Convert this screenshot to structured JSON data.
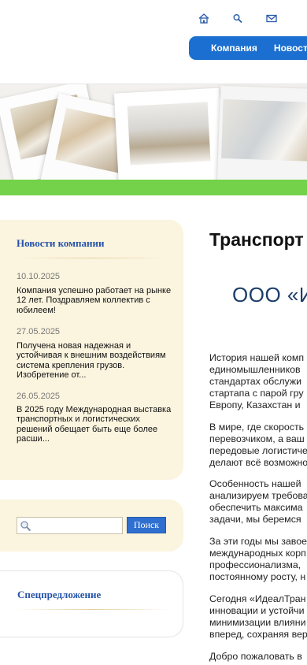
{
  "header": {
    "icons": [
      "home-icon",
      "search-icon",
      "mail-icon"
    ],
    "nav": [
      "Компания",
      "Новост"
    ]
  },
  "sidebar": {
    "news_title": "Новости компании",
    "news": [
      {
        "date": "10.10.2025",
        "text": "Компания успешно работает на рынке 12 лет. Поздравляем коллектив с юбилеем!"
      },
      {
        "date": "27.05.2025",
        "text": "Получена новая надежная и устойчивая к внешним воздействиям система крепления грузов. Изобретение от..."
      },
      {
        "date": "26.05.2025",
        "text": "В 2025 году Международная выставка транспортных и логистических решений обещает быть еще более расши..."
      }
    ],
    "search": {
      "placeholder": "",
      "button_label": "Поиск"
    },
    "special_title": "Спецпредложение"
  },
  "main": {
    "title": "Транспорт",
    "company": "ООО «И",
    "paragraphs": [
      [
        "История нашей комп",
        "единомышленников",
        "стандартах обслужи",
        "стартапа с парой гру",
        "Европу, Казахстан и"
      ],
      [
        "В мире, где скорость",
        "перевозчиком, а ваш",
        "передовые логистиче",
        "делают всё возможно"
      ],
      [
        "Особенность нашей",
        "анализируем требова",
        "обеспечить максима",
        "задачи, мы беремся"
      ],
      [
        "За эти годы мы завое",
        "международных корп",
        "профессионализма,",
        "постоянному росту, н"
      ],
      [
        "Сегодня «ИдеалТран",
        "инновации и устойчи",
        "минимизации влияни",
        "вперед, сохраняя вер"
      ],
      [
        "Добро пожаловать в"
      ]
    ]
  },
  "colors": {
    "nav_bg": "#1a6fd0",
    "sidebar_bg": "#fbf4df",
    "sidebar_title": "#2452a8",
    "banner_stripe": "#74d24a",
    "company_name": "#1c3d6a"
  }
}
